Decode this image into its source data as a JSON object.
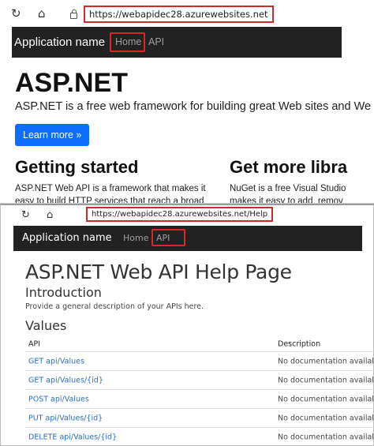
{
  "top": {
    "browser": {
      "url": "https://webapidec28.azurewebsites.net"
    },
    "navbar": {
      "brand": "Application name",
      "links": [
        {
          "label": "Home"
        },
        {
          "label": "API"
        }
      ]
    },
    "jumbotron": {
      "title": "ASP.NET",
      "lead": "ASP.NET is a free web framework for building great Web sites and We",
      "button": "Learn more »"
    },
    "columns": [
      {
        "heading": "Getting started",
        "lines": [
          "ASP.NET Web API is a framework that makes it",
          "easy to build HTTP services that reach a broad"
        ]
      },
      {
        "heading": "Get more libra",
        "lines": [
          "NuGet is a free Visual Studio",
          "makes it easy to add, remov"
        ]
      }
    ]
  },
  "bottom": {
    "browser": {
      "url": "https://webapidec28.azurewebsites.net/Help"
    },
    "navbar": {
      "brand": "Application name",
      "links": [
        {
          "label": "Home"
        },
        {
          "label": "API"
        }
      ]
    },
    "title": "ASP.NET Web API Help Page",
    "intro_heading": "Introduction",
    "intro_text": "Provide a general description of your APIs here.",
    "section_heading": "Values",
    "table": {
      "headers": {
        "api": "API",
        "description": "Description"
      },
      "rows": [
        {
          "api": "GET api/Values",
          "description": "No documentation availal"
        },
        {
          "api": "GET api/Values/{id}",
          "description": "No documentation availal"
        },
        {
          "api": "POST api/Values",
          "description": "No documentation availal"
        },
        {
          "api": "PUT api/Values/{id}",
          "description": "No documentation availal"
        },
        {
          "api": "DELETE api/Values/{id}",
          "description": "No documentation availal"
        }
      ]
    }
  }
}
